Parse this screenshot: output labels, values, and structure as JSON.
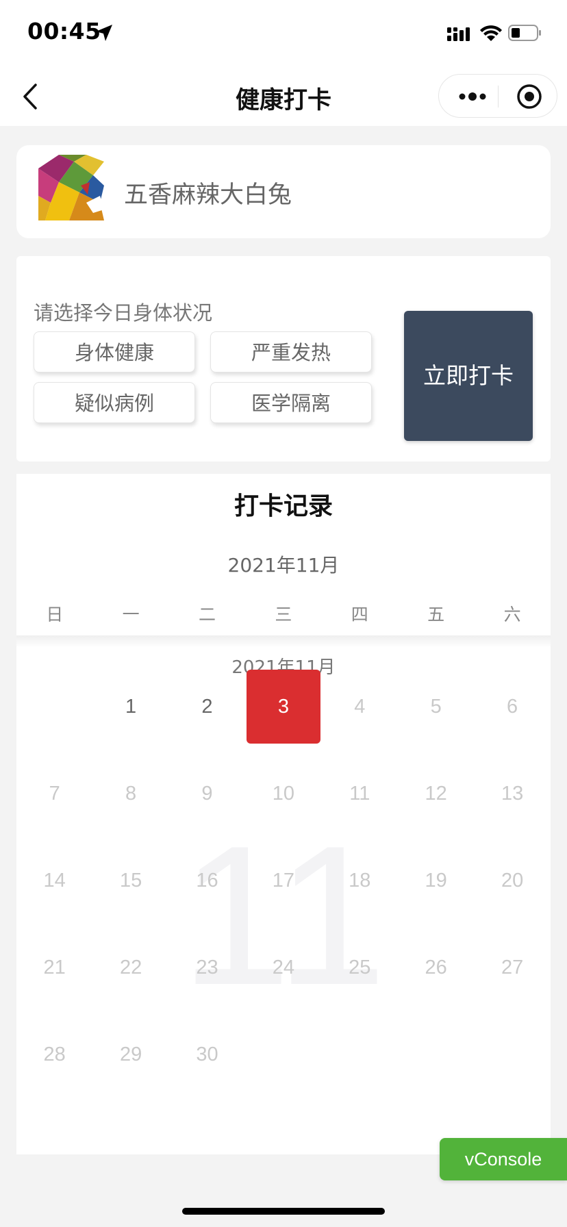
{
  "status_bar": {
    "time": "00:45"
  },
  "nav": {
    "title": "健康打卡"
  },
  "profile": {
    "name": "五香麻辣大白兔"
  },
  "checkin": {
    "prompt": "请选择今日身体状况",
    "options": [
      "身体健康",
      "严重发热",
      "疑似病例",
      "医学隔离"
    ],
    "submit_label": "立即打卡"
  },
  "records": {
    "title": "打卡记录",
    "month_header": "2021年11月",
    "month_label": "2021年11月",
    "month_watermark": "11",
    "weekdays": [
      "日",
      "一",
      "二",
      "三",
      "四",
      "五",
      "六"
    ],
    "first_weekday_index": 1,
    "days_in_month": 30,
    "today": 3,
    "colors": {
      "today_bg": "#da2e30",
      "past_text": "#666666",
      "future_text": "#c9c9c9"
    }
  },
  "vconsole": {
    "label": "vConsole"
  }
}
